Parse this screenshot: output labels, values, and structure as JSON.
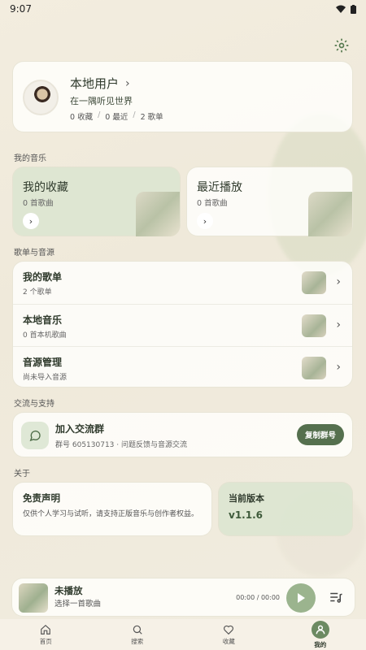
{
  "status": {
    "time": "9:07"
  },
  "profile": {
    "name": "本地用户",
    "tagline": "在一隅听见世界",
    "stats": [
      "0 收藏",
      "0 最近",
      "2 歌单"
    ]
  },
  "sections": {
    "my_music": "我的音乐",
    "playlists": "歌单与音源",
    "community": "交流与支持",
    "about": "关于"
  },
  "tiles": [
    {
      "title": "我的收藏",
      "sub": "0 首歌曲"
    },
    {
      "title": "最近播放",
      "sub": "0 首歌曲"
    }
  ],
  "rows": [
    {
      "title": "我的歌单",
      "sub": "2 个歌单"
    },
    {
      "title": "本地音乐",
      "sub": "0 首本机歌曲"
    },
    {
      "title": "音源管理",
      "sub": "尚未导入音源"
    }
  ],
  "join": {
    "title": "加入交流群",
    "sub": "群号 605130713 · 问题反馈与音源交流",
    "button": "复制群号"
  },
  "disclaimer": {
    "title": "免责声明",
    "text": "仅供个人学习与试听，请支持正版音乐与创作者权益。"
  },
  "version": {
    "title": "当前版本",
    "value": "v1.1.6"
  },
  "player": {
    "title": "未播放",
    "sub": "选择一首歌曲",
    "time": "00:00 / 00:00"
  },
  "nav": [
    {
      "label": "首页",
      "icon": "home-icon"
    },
    {
      "label": "搜索",
      "icon": "search-icon"
    },
    {
      "label": "收藏",
      "icon": "heart-icon"
    },
    {
      "label": "我的",
      "icon": "user-icon"
    }
  ],
  "colors": {
    "accent": "#55704e",
    "tile_green": "#dae5d0",
    "play": "#9bb48e"
  }
}
